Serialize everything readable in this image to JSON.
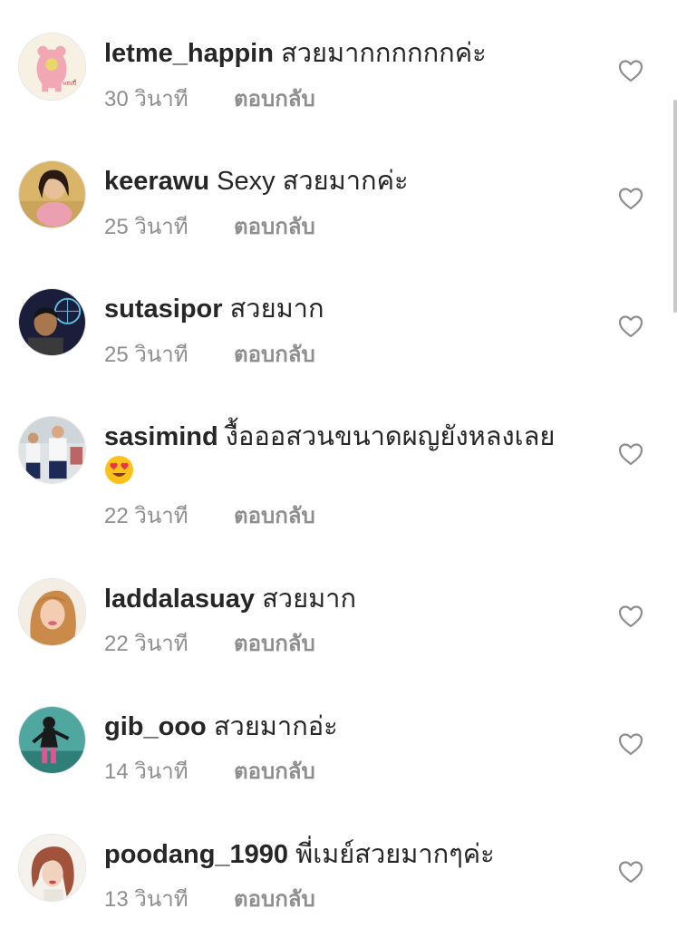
{
  "comments": [
    {
      "username": "letme_happin",
      "text": "สวยมากกกกกกค่ะ",
      "time": "30 วินาที",
      "reply": "ตอบกลับ"
    },
    {
      "username": "keerawu",
      "text": "Sexy สวยมากค่ะ",
      "time": "25 วินาที",
      "reply": "ตอบกลับ"
    },
    {
      "username": "sutasipor",
      "text": "สวยมาก",
      "time": "25 วินาที",
      "reply": "ตอบกลับ"
    },
    {
      "username": "sasimind",
      "text": "งื้อออสวนขนาดผญยังหลงเลย",
      "time": "22 วินาที",
      "reply": "ตอบกลับ",
      "emoji": "heart-eyes-emoji"
    },
    {
      "username": "laddalasuay",
      "text": "สวยมาก",
      "time": "22 วินาที",
      "reply": "ตอบกลับ"
    },
    {
      "username": "gib_ooo",
      "text": "สวยมากอ่ะ",
      "time": "14 วินาที",
      "reply": "ตอบกลับ"
    },
    {
      "username": "poodang_1990",
      "text": "พี่เมย์สวยมากๆค่ะ",
      "time": "13 วินาที",
      "reply": "ตอบกลับ"
    }
  ],
  "icons": {
    "like": "heart-outline-icon",
    "emoji": "heart-eyes-emoji"
  },
  "colors": {
    "text": "#262626",
    "meta": "#8e8e8e",
    "background": "#ffffff"
  }
}
